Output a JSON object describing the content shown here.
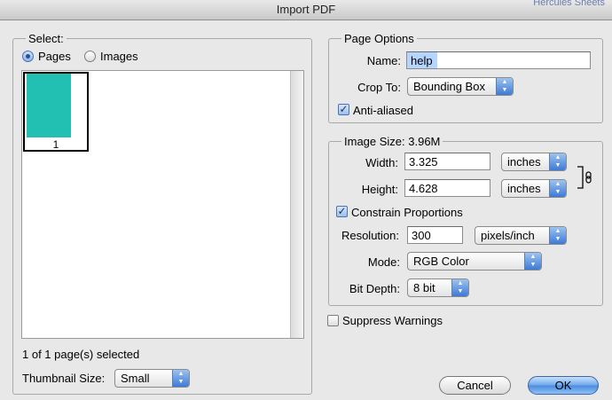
{
  "window": {
    "title": "Import PDF",
    "background_text": "Hercules Sheets"
  },
  "select": {
    "group_label": "Select:",
    "options": [
      "Pages",
      "Images"
    ],
    "selected": "Pages",
    "thumbnails": [
      {
        "page_number": "1",
        "color": "#22bfb3"
      }
    ],
    "status": "1 of 1 page(s) selected",
    "thumbnail_size_label": "Thumbnail Size:",
    "thumbnail_size_value": "Small"
  },
  "page_options": {
    "group_label": "Page Options",
    "name_label": "Name:",
    "name_value": "help",
    "crop_label": "Crop To:",
    "crop_value": "Bounding Box",
    "anti_aliased_label": "Anti-aliased",
    "anti_aliased_checked": true
  },
  "image_size": {
    "group_label": "Image Size: 3.96M",
    "width_label": "Width:",
    "width_value": "3.325",
    "width_unit": "inches",
    "height_label": "Height:",
    "height_value": "4.628",
    "height_unit": "inches",
    "constrain_label": "Constrain Proportions",
    "constrain_checked": true,
    "resolution_label": "Resolution:",
    "resolution_value": "300",
    "resolution_unit": "pixels/inch",
    "mode_label": "Mode:",
    "mode_value": "RGB Color",
    "bit_depth_label": "Bit Depth:",
    "bit_depth_value": "8 bit"
  },
  "suppress_warnings": {
    "label": "Suppress Warnings",
    "checked": false
  },
  "buttons": {
    "cancel": "Cancel",
    "ok": "OK"
  },
  "icons": {
    "checkmark": "✓",
    "popup_arrows": "updown-arrows-icon",
    "link": "chain-link-icon"
  }
}
